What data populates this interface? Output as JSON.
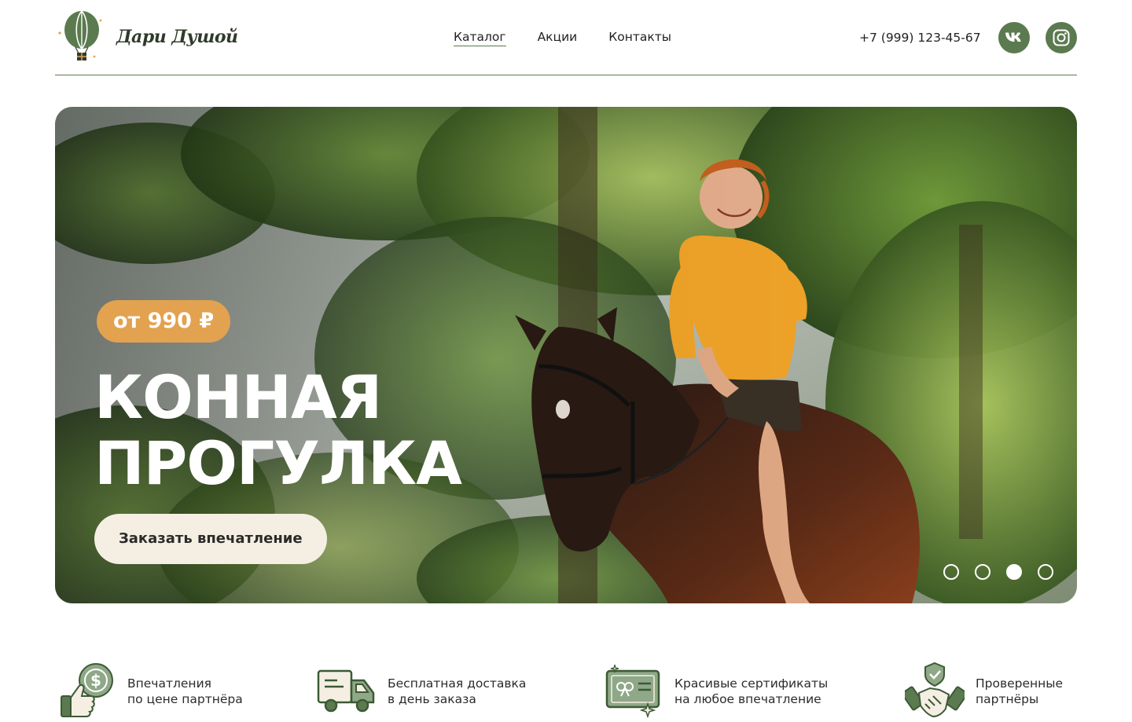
{
  "brand": {
    "name": "Дари Душой"
  },
  "nav": [
    {
      "label": "Каталог",
      "active": true
    },
    {
      "label": "Акции",
      "active": false
    },
    {
      "label": "Контакты",
      "active": false
    }
  ],
  "contact": {
    "phone": "+7 (999) 123-45-67"
  },
  "social": [
    {
      "icon": "vk-icon"
    },
    {
      "icon": "instagram-icon"
    }
  ],
  "hero": {
    "price": "от 990 ₽",
    "title_line1": "КОННАЯ",
    "title_line2": "ПРОГУЛКА",
    "cta": "Заказать впечатление",
    "slides_total": 4,
    "active_slide": 3
  },
  "features": [
    {
      "icon": "thumbs-up-coin-icon",
      "line1": "Впечатления",
      "line2": "по цене партнёра"
    },
    {
      "icon": "delivery-truck-icon",
      "line1": "Бесплатная доставка",
      "line2": "в день заказа"
    },
    {
      "icon": "gift-certificate-icon",
      "line1": "Красивые сертификаты",
      "line2": "на любое впечатление"
    },
    {
      "icon": "handshake-shield-icon",
      "line1": "Проверенные",
      "line2": "партнёры"
    }
  ],
  "colors": {
    "accent": "#5b7a4f",
    "badge": "#e3a24f",
    "cta_bg": "#f5efe3"
  }
}
